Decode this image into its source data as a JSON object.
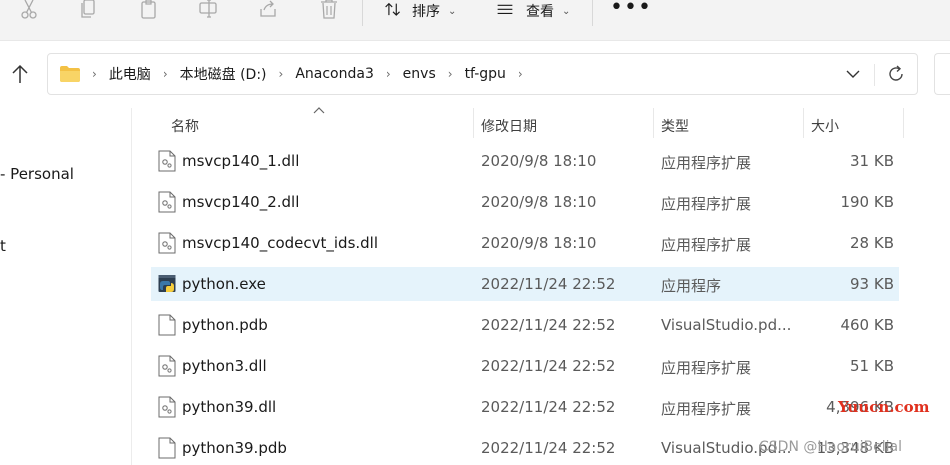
{
  "toolbar": {
    "sort_label": "排序",
    "view_label": "查看",
    "more_label": "•••"
  },
  "address": {
    "crumbs": [
      "此电脑",
      "本地磁盘 (D:)",
      "Anaconda3",
      "envs",
      "tf-gpu"
    ]
  },
  "nav": {
    "personal_text": "- Personal",
    "partial_text": "t"
  },
  "columns": {
    "name": "名称",
    "date": "修改日期",
    "type": "类型",
    "size": "大小"
  },
  "files": [
    {
      "name": "msvcp140_1.dll",
      "date": "2020/9/8 18:10",
      "type": "应用程序扩展",
      "size": "31 KB",
      "icon": "dll-file-icon"
    },
    {
      "name": "msvcp140_2.dll",
      "date": "2020/9/8 18:10",
      "type": "应用程序扩展",
      "size": "190 KB",
      "icon": "dll-file-icon"
    },
    {
      "name": "msvcp140_codecvt_ids.dll",
      "date": "2020/9/8 18:10",
      "type": "应用程序扩展",
      "size": "28 KB",
      "icon": "dll-file-icon"
    },
    {
      "name": "python.exe",
      "date": "2022/11/24 22:52",
      "type": "应用程序",
      "size": "93 KB",
      "icon": "python-exe-icon"
    },
    {
      "name": "python.pdb",
      "date": "2022/11/24 22:52",
      "type": "VisualStudio.pd...",
      "size": "460 KB",
      "icon": "blank-file-icon"
    },
    {
      "name": "python3.dll",
      "date": "2022/11/24 22:52",
      "type": "应用程序扩展",
      "size": "51 KB",
      "icon": "dll-file-icon"
    },
    {
      "name": "python39.dll",
      "date": "2022/11/24 22:52",
      "type": "应用程序扩展",
      "size": "4,396 KB",
      "icon": "dll-file-icon"
    },
    {
      "name": "python39.pdb",
      "date": "2022/11/24 22:52",
      "type": "VisualStudio.pd...",
      "size": "13,348 KB",
      "icon": "blank-file-icon"
    }
  ],
  "watermarks": {
    "site": "Yuucn.com",
    "author": "CSDN @HaoruiBelial"
  },
  "colors": {
    "selected_row": "#e5f3fb",
    "folder": "#f3c145",
    "watermark_red": "#e0301e"
  }
}
